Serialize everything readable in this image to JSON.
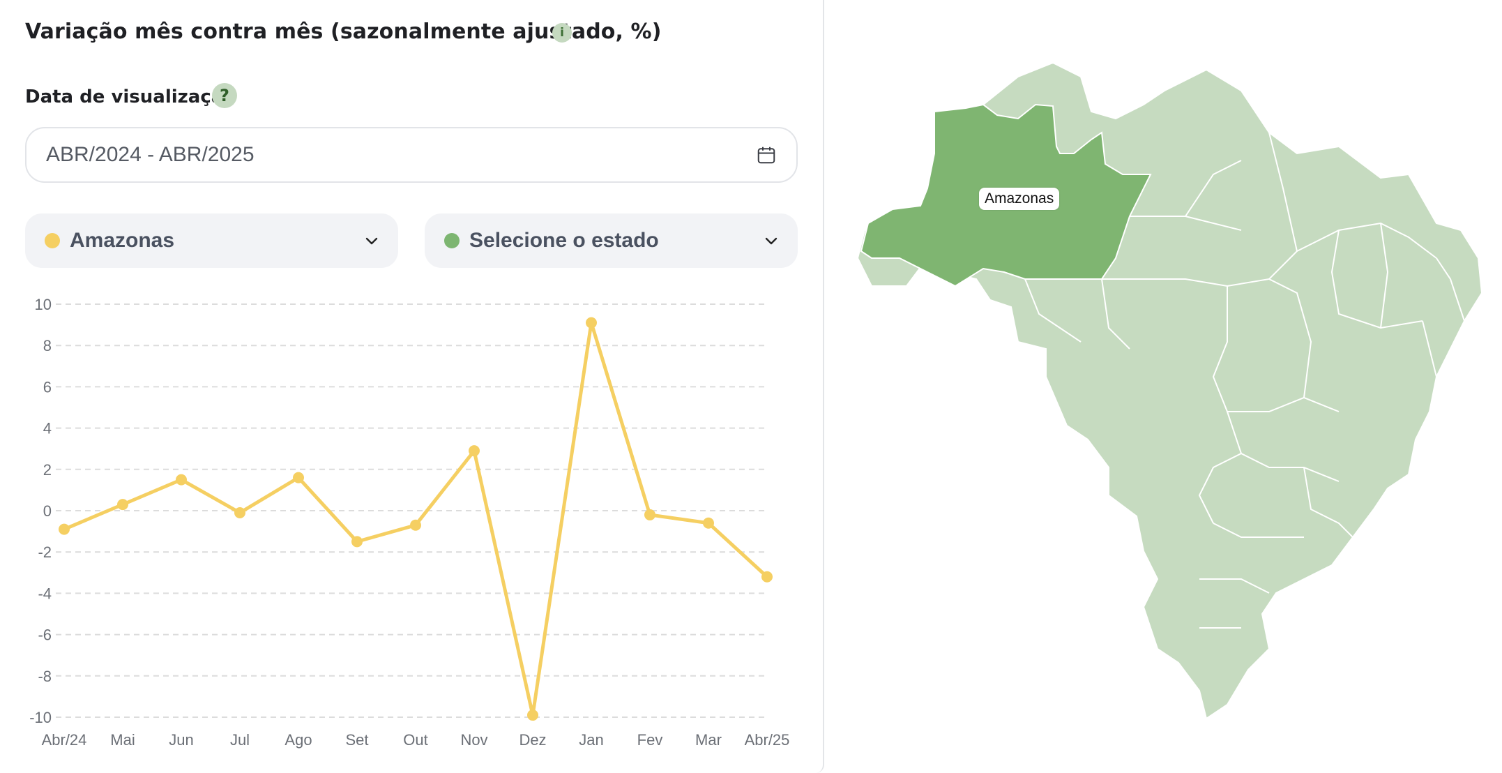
{
  "header": {
    "title": "Variação mês contra mês (sazonalmente ajustado, %)",
    "info_icon_glyph": "i"
  },
  "date_filter": {
    "label": "Data de visualização",
    "help_glyph": "?",
    "value": "ABR/2024 - ABR/2025",
    "icon": "calendar-icon"
  },
  "selectors": [
    {
      "label": "Amazonas",
      "dot_color": "#f5cf62",
      "icon": "chevron-down-icon"
    },
    {
      "label": "Selecione o estado",
      "dot_color": "#7db571",
      "icon": "chevron-down-icon"
    }
  ],
  "chart_data": {
    "type": "line",
    "categories": [
      "Abr/24",
      "Mai",
      "Jun",
      "Jul",
      "Ago",
      "Set",
      "Out",
      "Nov",
      "Dez",
      "Jan",
      "Fev",
      "Mar",
      "Abr/25"
    ],
    "series": [
      {
        "name": "Amazonas",
        "color": "#f5cf62",
        "values": [
          -0.9,
          0.3,
          1.5,
          -0.1,
          1.6,
          -1.5,
          -0.7,
          2.9,
          -9.9,
          9.1,
          -0.2,
          -0.6,
          -3.2
        ]
      }
    ],
    "yticks": [
      10,
      8,
      6,
      4,
      2,
      0,
      -2,
      -4,
      -6,
      -8,
      -10
    ],
    "ylim": [
      -10,
      10
    ],
    "grid": true,
    "title": "",
    "xlabel": "",
    "ylabel": ""
  },
  "map": {
    "highlighted_state": "Amazonas",
    "highlight_color": "#7fb571",
    "base_color": "#c6dbc0"
  }
}
